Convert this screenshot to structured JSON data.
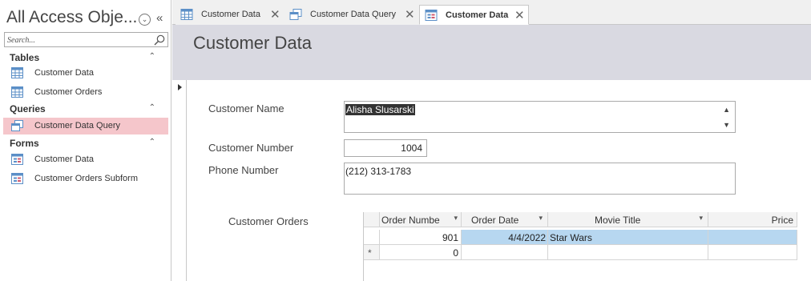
{
  "nav": {
    "title": "All Access Obje...",
    "menu_icon": "circle-chevron-down-icon",
    "collapse_icon": "double-chevron-left-icon",
    "search_placeholder": "Search...",
    "groups": [
      {
        "label": "Tables",
        "items": [
          {
            "label": "Customer Data",
            "icon": "table-icon"
          },
          {
            "label": "Customer Orders",
            "icon": "table-icon"
          }
        ]
      },
      {
        "label": "Queries",
        "items": [
          {
            "label": "Customer Data Query",
            "icon": "query-icon",
            "selected": true
          }
        ]
      },
      {
        "label": "Forms",
        "items": [
          {
            "label": "Customer Data",
            "icon": "form-icon"
          },
          {
            "label": "Customer Orders Subform",
            "icon": "form-icon"
          }
        ]
      }
    ]
  },
  "tabs": [
    {
      "label": "Customer Data",
      "icon": "table-icon"
    },
    {
      "label": "Customer Data Query",
      "icon": "query-icon"
    },
    {
      "label": "Customer Data",
      "icon": "form-icon",
      "active": true
    }
  ],
  "form": {
    "title": "Customer Data",
    "customer_name_label": "Customer Name",
    "customer_name_value": "Alisha Slusarski",
    "customer_number_label": "Customer Number",
    "customer_number_value": "1004",
    "phone_label": "Phone Number",
    "phone_value": "(212) 313-1783",
    "orders_label": "Customer Orders"
  },
  "orders": {
    "columns": [
      "Order Numbe",
      "Order Date",
      "Movie Title",
      "Price"
    ],
    "rows": [
      {
        "selector": "",
        "order_number": "901",
        "order_date": "4/4/2022",
        "movie_title": "Star Wars",
        "price": ""
      },
      {
        "selector": "*",
        "order_number": "0",
        "order_date": "",
        "movie_title": "",
        "price": ""
      }
    ]
  },
  "colors": {
    "selected_nav": "#f5c6cb",
    "header_band": "#d9d9e1",
    "selected_row": "#b7d7f0"
  }
}
